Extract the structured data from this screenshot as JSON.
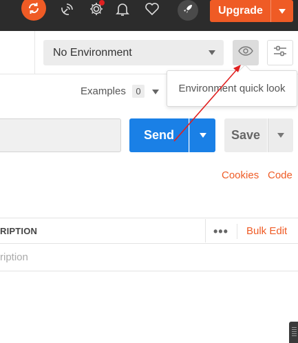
{
  "header": {
    "upgrade_label": "Upgrade",
    "icons": [
      "sync-icon",
      "satellite-icon",
      "gear-icon",
      "bell-icon",
      "heart-icon",
      "rocket-icon"
    ]
  },
  "environment": {
    "selected": "No Environment",
    "tooltip": "Environment quick look"
  },
  "request": {
    "examples_label": "Examples",
    "examples_count": "0",
    "send_label": "Send",
    "save_label": "Save",
    "cookies_label": "Cookies",
    "code_label": "Code"
  },
  "params_table": {
    "description_header": "RIPTION",
    "more_label": "•••",
    "bulk_edit_label": "Bulk Edit",
    "description_placeholder": "ription"
  },
  "colors": {
    "accent": "#ef5b25",
    "primary": "#1a80e6",
    "header_bg": "#2c2c2c",
    "annotation": "#e02020"
  }
}
